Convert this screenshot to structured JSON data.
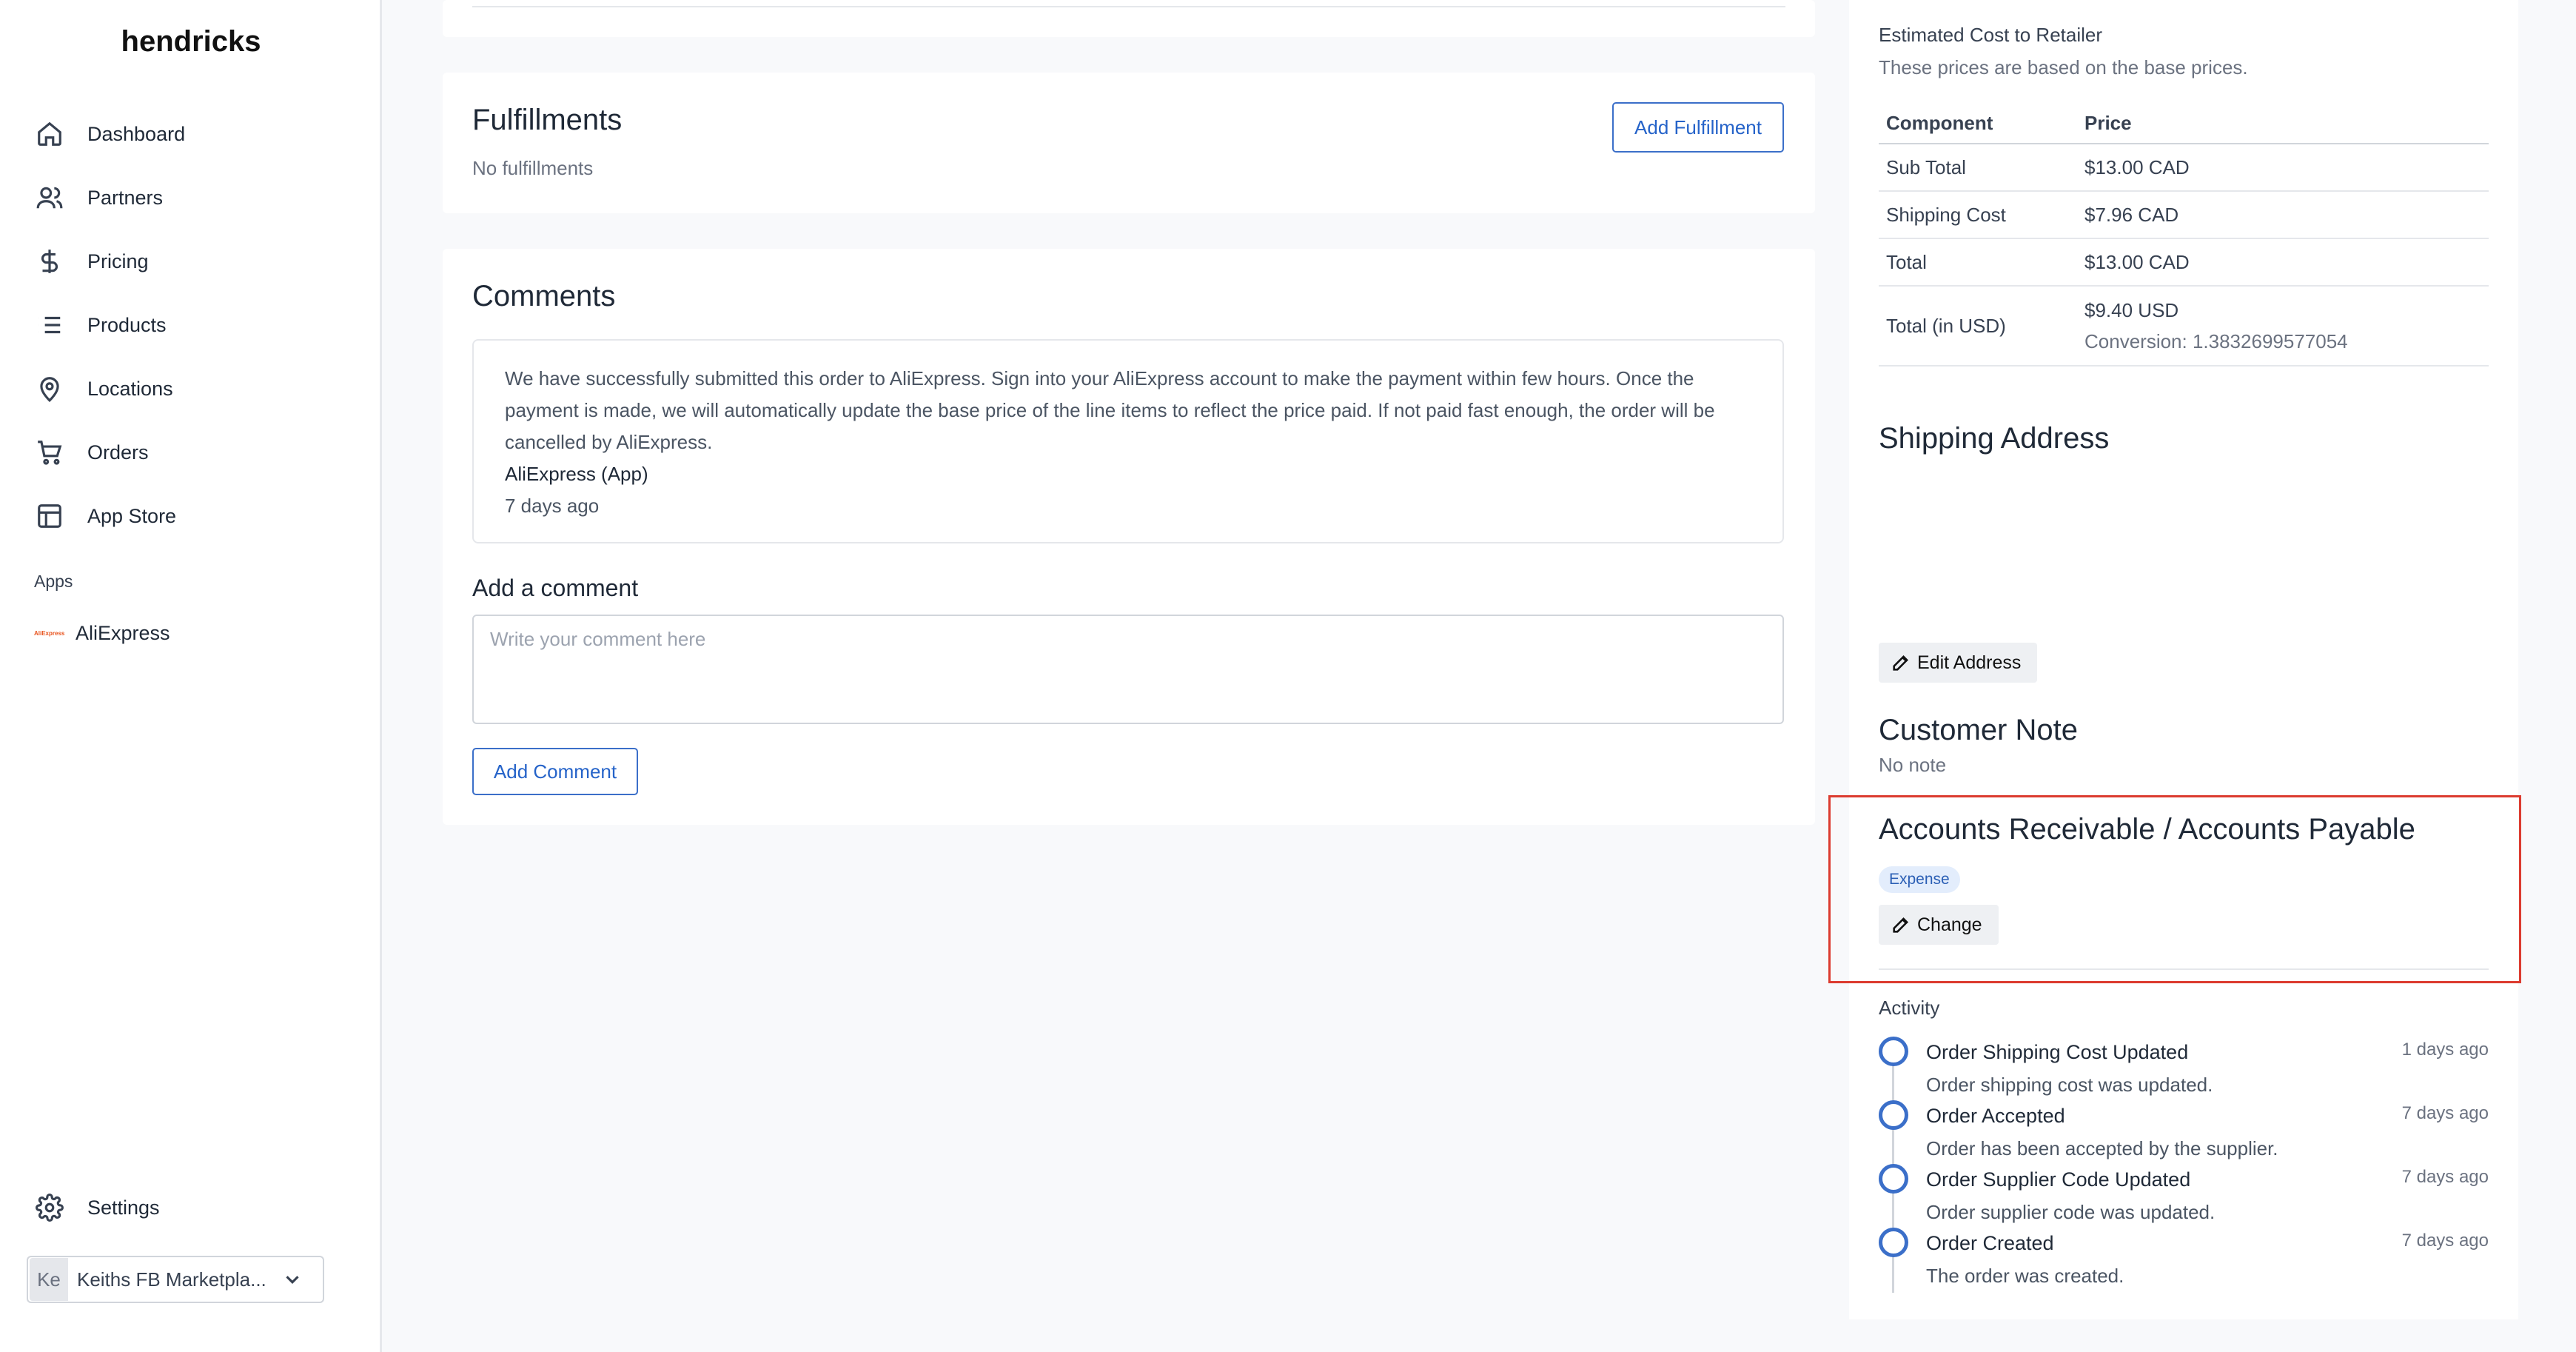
{
  "sidebar": {
    "brand": "hendricks",
    "nav": [
      {
        "label": "Dashboard",
        "icon": "home-icon"
      },
      {
        "label": "Partners",
        "icon": "users-icon"
      },
      {
        "label": "Pricing",
        "icon": "dollar-icon"
      },
      {
        "label": "Products",
        "icon": "list-icon"
      },
      {
        "label": "Locations",
        "icon": "map-pin-icon"
      },
      {
        "label": "Orders",
        "icon": "cart-icon"
      },
      {
        "label": "App Store",
        "icon": "layout-icon"
      }
    ],
    "apps_title": "Apps",
    "apps": [
      {
        "label": "AliExpress",
        "logo_text": "AliExpress"
      }
    ],
    "settings_label": "Settings",
    "account": {
      "initials": "Ke",
      "name": "Keiths FB Marketpla..."
    }
  },
  "fulfillments": {
    "title": "Fulfillments",
    "empty": "No fulfillments",
    "add_button": "Add Fulfillment"
  },
  "comments": {
    "title": "Comments",
    "items": [
      {
        "text": "We have successfully submitted this order to AliExpress. Sign into your AliExpress account to make the payment within few hours. Once the payment is made, we will automatically update the base price of the line items to reflect the price paid. If not paid fast enough, the order will be cancelled by AliExpress.",
        "author": "AliExpress (App)",
        "time": "7 days ago"
      }
    ],
    "add_title": "Add a comment",
    "placeholder": "Write your comment here",
    "add_button": "Add Comment"
  },
  "cost": {
    "title": "Estimated Cost to Retailer",
    "subtitle": "These prices are based on the base prices.",
    "headers": [
      "Component",
      "Price"
    ],
    "rows": [
      {
        "component": "Sub Total",
        "price": "$13.00 CAD"
      },
      {
        "component": "Shipping Cost",
        "price": "$7.96 CAD"
      },
      {
        "component": "Total",
        "price": "$13.00 CAD"
      },
      {
        "component": "Total (in USD)",
        "price": "$9.40 USD",
        "note": "Conversion: 1.3832699577054"
      }
    ]
  },
  "shipping": {
    "title": "Shipping Address",
    "edit_button": "Edit Address"
  },
  "customer_note": {
    "title": "Customer Note",
    "value": "No note"
  },
  "ar_ap": {
    "title": "Accounts Receivable / Accounts Payable",
    "badge": "Expense",
    "change_button": "Change"
  },
  "activity": {
    "title": "Activity",
    "items": [
      {
        "title": "Order Shipping Cost Updated",
        "desc": "Order shipping cost was updated.",
        "time": "1 days ago"
      },
      {
        "title": "Order Accepted",
        "desc": "Order has been accepted by the supplier.",
        "time": "7 days ago"
      },
      {
        "title": "Order Supplier Code Updated",
        "desc": "Order supplier code was updated.",
        "time": "7 days ago"
      },
      {
        "title": "Order Created",
        "desc": "The order was created.",
        "time": "7 days ago"
      }
    ]
  },
  "colors": {
    "accent": "#3b6fc9",
    "highlight": "#dc3b2f",
    "badge_bg": "#e3edfc"
  }
}
